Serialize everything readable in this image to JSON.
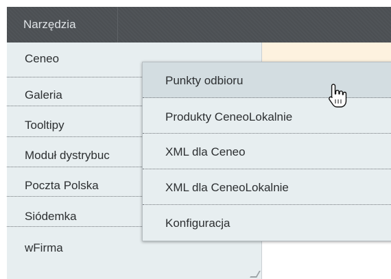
{
  "menubar": {
    "tools_label": "Narzędzia"
  },
  "sidebar": {
    "items": [
      {
        "label": "Ceneo"
      },
      {
        "label": "Galeria"
      },
      {
        "label": "Tooltipy"
      },
      {
        "label": "Moduł dystrybuc"
      },
      {
        "label": "Poczta Polska"
      },
      {
        "label": "Siódemka"
      },
      {
        "label": "wFirma"
      }
    ]
  },
  "submenu": {
    "items": [
      {
        "label": "Punkty odbioru"
      },
      {
        "label": "Produkty CeneoLokalnie"
      },
      {
        "label": "XML dla Ceneo"
      },
      {
        "label": "XML dla CeneoLokalnie"
      },
      {
        "label": "Konfiguracja"
      }
    ]
  },
  "colors": {
    "menubar_bg": "#4d5155",
    "dropdown_bg": "#e7eef0",
    "hover_bg": "#d3dde1",
    "content_highlight": "#fdf2df"
  },
  "cursor": {
    "icon": "hand-pointer-icon"
  }
}
